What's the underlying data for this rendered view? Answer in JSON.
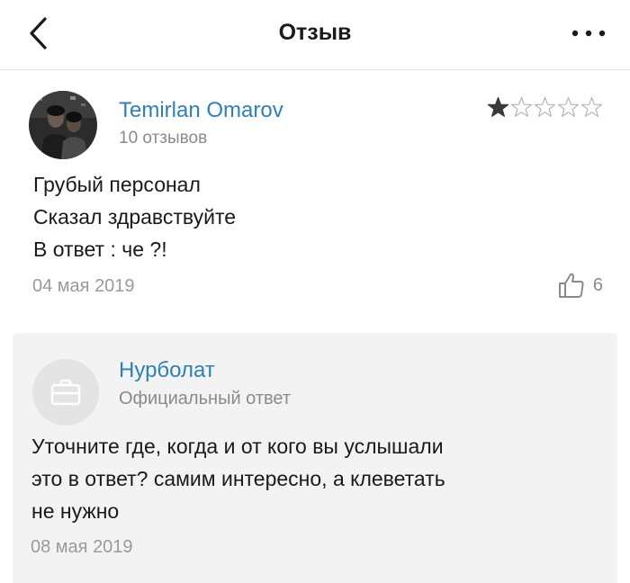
{
  "header": {
    "title": "Отзыв",
    "back_icon": "chevron-left-icon",
    "more_icon": "more-dots-icon"
  },
  "review": {
    "author": "Temirlan Omarov",
    "reviews_count": "10 отзывов",
    "rating": 1,
    "rating_max": 5,
    "text_lines": [
      "Грубый персонал",
      "Сказал здравствуйте",
      "В ответ : че ?!"
    ],
    "date": "04 мая 2019",
    "likes": "6"
  },
  "reply": {
    "author": "Нурболат",
    "label": "Официальный ответ",
    "text_lines": [
      "Уточните где, когда и от кого вы услышали",
      "это в ответ? самим интересно, а клеветать",
      "не нужно"
    ],
    "date": "08 мая 2019"
  },
  "colors": {
    "link_blue": "#2f80b5",
    "muted_gray": "#8a8a8a",
    "reply_bg": "#f3f3f3"
  }
}
